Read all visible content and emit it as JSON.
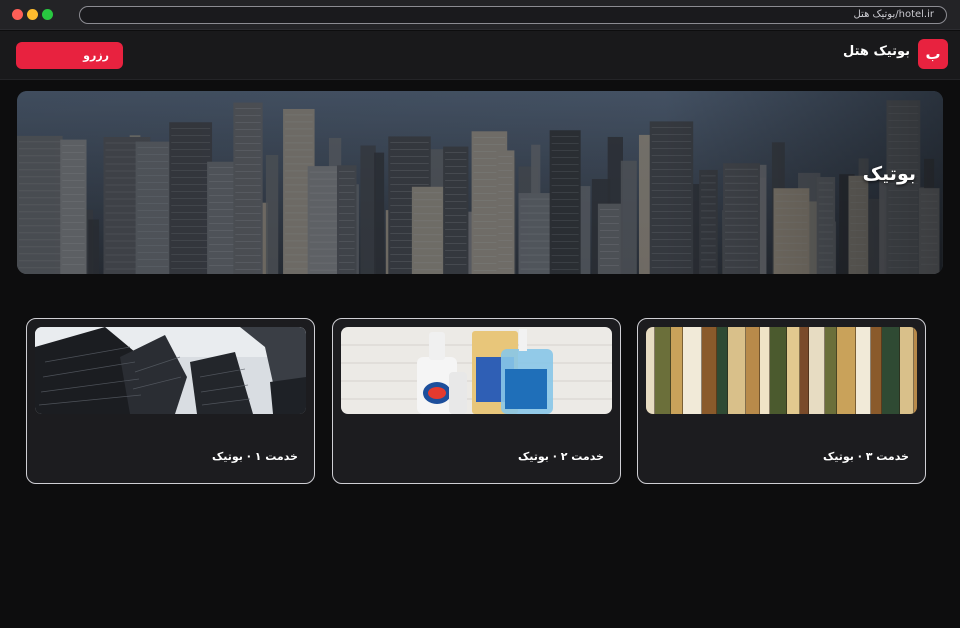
{
  "browser": {
    "url": "hotel.ir/بوتیک هتل"
  },
  "header": {
    "logo_letter": "ب",
    "brand": "بوتیک هتل",
    "reserve_label": "رزرو"
  },
  "hero": {
    "title": "بوتیک"
  },
  "cards": [
    {
      "title": "خدمت ۱ · بوتیک",
      "image": "skyscrapers-photo"
    },
    {
      "title": "خدمت ۲ · بوتیک",
      "image": "cleaning-products-photo"
    },
    {
      "title": "خدمت ۳ · بوتیک",
      "image": "clothing-rack-photo"
    }
  ],
  "colors": {
    "accent": "#e8223f",
    "background": "#0d0d0e",
    "card": "#1c1c1f"
  }
}
